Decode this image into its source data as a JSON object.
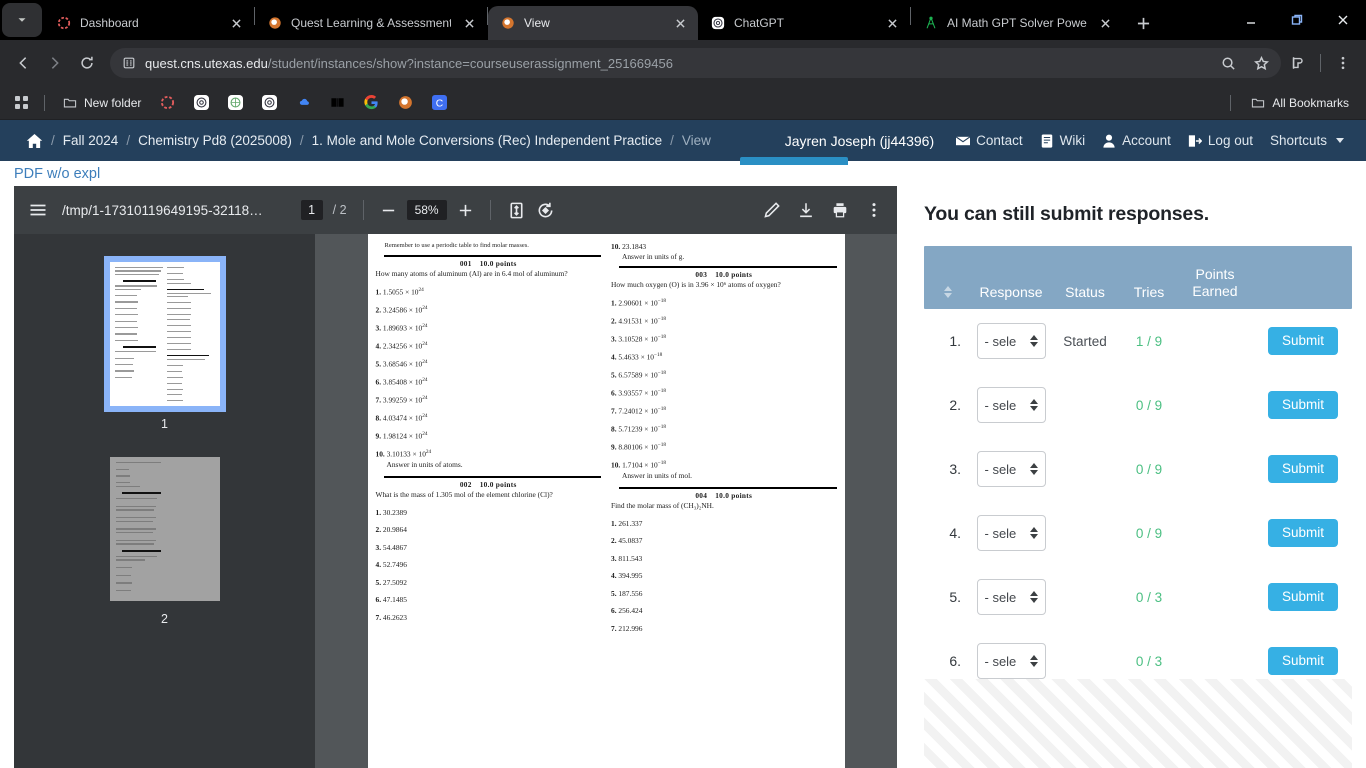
{
  "browser": {
    "tabs": [
      {
        "title": "Dashboard",
        "favicon": "quest-dashboard-icon",
        "active": false
      },
      {
        "title": "Quest Learning & Assessment",
        "favicon": "quest-icon",
        "active": false
      },
      {
        "title": "View",
        "favicon": "quest-icon",
        "active": true
      },
      {
        "title": "ChatGPT",
        "favicon": "openai-icon",
        "active": false
      },
      {
        "title": "AI Math GPT Solver Powered",
        "favicon": "compass-icon",
        "active": false
      }
    ],
    "url_domain": "quest.cns.utexas.edu",
    "url_path": "/student/instances/show?instance=courseuserassignment_251669456",
    "bookmarks": {
      "new_folder": "New folder",
      "all_bookmarks": "All Bookmarks"
    }
  },
  "navbar": {
    "breadcrumbs": [
      {
        "label": "Fall 2024"
      },
      {
        "label": "Chemistry Pd8  (2025008)"
      },
      {
        "label": "1. Mole and Mole Conversions (Rec) Independent Practice"
      },
      {
        "label": "View"
      }
    ],
    "separator": "/",
    "user": "Jayren Joseph (jj44396)",
    "links": [
      {
        "label": "Contact",
        "icon": "envelope-icon"
      },
      {
        "label": "Wiki",
        "icon": "book-icon"
      },
      {
        "label": "Account",
        "icon": "user-icon"
      },
      {
        "label": "Log out",
        "icon": "logout-icon"
      },
      {
        "label": "Shortcuts",
        "icon": "caret-down-icon"
      }
    ]
  },
  "pdf_link_label": "PDF w/o expl",
  "pdf_viewer": {
    "filename": "/tmp/1-17310119649195-32118…",
    "current_page": "1",
    "total_pages": "/ 2",
    "zoom": "58%",
    "thumbnails": [
      {
        "label": "1",
        "selected": true
      },
      {
        "label": "2",
        "selected": false
      }
    ],
    "toolbar_icons": [
      "menu-icon",
      "minus-icon",
      "plus-icon",
      "fit-page-icon",
      "rotate-icon",
      "annotate-pencil-icon",
      "download-icon",
      "print-icon",
      "more-vertical-icon"
    ]
  },
  "document": {
    "intro": "Remember to use a periodic table to find molar masses.",
    "columns": [
      {
        "blocks": [
          {
            "type": "question",
            "number": "001",
            "points": "10.0 points",
            "prompt": "How many atoms of aluminum (Al) are in 6.4 mol of aluminum?",
            "choices": [
              {
                "n": "1.",
                "mantissa": "1.5055 ×",
                "base": "10",
                "exp": "24"
              },
              {
                "n": "2.",
                "mantissa": "3.24586 ×",
                "base": "10",
                "exp": "24"
              },
              {
                "n": "3.",
                "mantissa": "1.89693 ×",
                "base": "10",
                "exp": "24"
              },
              {
                "n": "4.",
                "mantissa": "2.34256 ×",
                "base": "10",
                "exp": "24"
              },
              {
                "n": "5.",
                "mantissa": "3.68546 ×",
                "base": "10",
                "exp": "24"
              },
              {
                "n": "6.",
                "mantissa": "3.85408 ×",
                "base": "10",
                "exp": "24"
              },
              {
                "n": "7.",
                "mantissa": "3.99259 ×",
                "base": "10",
                "exp": "24"
              },
              {
                "n": "8.",
                "mantissa": "4.03474 ×",
                "base": "10",
                "exp": "24"
              },
              {
                "n": "9.",
                "mantissa": "1.98124 ×",
                "base": "10",
                "exp": "24"
              },
              {
                "n": "10.",
                "mantissa": "3.10133 ×",
                "base": "10",
                "exp": "24"
              }
            ],
            "answer_units": "Answer in units of  atoms."
          },
          {
            "type": "question",
            "number": "002",
            "points": "10.0 points",
            "prompt": "What is the mass of 1.305 mol of the element chlorine (Cl)?",
            "choices": [
              {
                "n": "1.",
                "mantissa": "30.2389",
                "base": "",
                "exp": ""
              },
              {
                "n": "2.",
                "mantissa": "20.9864",
                "base": "",
                "exp": ""
              },
              {
                "n": "3.",
                "mantissa": "54.4867",
                "base": "",
                "exp": ""
              },
              {
                "n": "4.",
                "mantissa": "52.7496",
                "base": "",
                "exp": ""
              },
              {
                "n": "5.",
                "mantissa": "27.5092",
                "base": "",
                "exp": ""
              },
              {
                "n": "6.",
                "mantissa": "47.1485",
                "base": "",
                "exp": ""
              },
              {
                "n": "7.",
                "mantissa": "46.2623",
                "base": "",
                "exp": ""
              }
            ],
            "answer_units": ""
          }
        ]
      },
      {
        "blocks": [
          {
            "type": "tail",
            "number": "",
            "points": "",
            "prompt": "",
            "choices": [
              {
                "n": "10.",
                "mantissa": "23.1843",
                "base": "",
                "exp": ""
              }
            ],
            "answer_units": "Answer in units of  g."
          },
          {
            "type": "question",
            "number": "003",
            "points": "10.0 points",
            "prompt": "How much oxygen (O) is in 3.96 × 10⁶ atoms of oxygen?",
            "choices": [
              {
                "n": "1.",
                "mantissa": "2.90601 ×",
                "base": "10",
                "exp": "−18"
              },
              {
                "n": "2.",
                "mantissa": "4.91531 ×",
                "base": "10",
                "exp": "−18"
              },
              {
                "n": "3.",
                "mantissa": "3.10528 ×",
                "base": "10",
                "exp": "−18"
              },
              {
                "n": "4.",
                "mantissa": "5.4633 ×",
                "base": "10",
                "exp": "−18"
              },
              {
                "n": "5.",
                "mantissa": "6.57589 ×",
                "base": "10",
                "exp": "−18"
              },
              {
                "n": "6.",
                "mantissa": "3.93557 ×",
                "base": "10",
                "exp": "−18"
              },
              {
                "n": "7.",
                "mantissa": "7.24012 ×",
                "base": "10",
                "exp": "−18"
              },
              {
                "n": "8.",
                "mantissa": "5.71239 ×",
                "base": "10",
                "exp": "−18"
              },
              {
                "n": "9.",
                "mantissa": "8.80106 ×",
                "base": "10",
                "exp": "−18"
              },
              {
                "n": "10.",
                "mantissa": "1.7104 ×",
                "base": "10",
                "exp": "−18"
              }
            ],
            "answer_units": "Answer in units of  mol."
          },
          {
            "type": "question",
            "number": "004",
            "points": "10.0 points",
            "prompt": "Find the molar mass of (CH₃)₂NH.",
            "choices": [
              {
                "n": "1.",
                "mantissa": "261.337",
                "base": "",
                "exp": ""
              },
              {
                "n": "2.",
                "mantissa": "45.0837",
                "base": "",
                "exp": ""
              },
              {
                "n": "3.",
                "mantissa": "811.543",
                "base": "",
                "exp": ""
              },
              {
                "n": "4.",
                "mantissa": "394.995",
                "base": "",
                "exp": ""
              },
              {
                "n": "5.",
                "mantissa": "187.556",
                "base": "",
                "exp": ""
              },
              {
                "n": "6.",
                "mantissa": "256.424",
                "base": "",
                "exp": ""
              },
              {
                "n": "7.",
                "mantissa": "212.996",
                "base": "",
                "exp": ""
              }
            ],
            "answer_units": ""
          }
        ]
      }
    ]
  },
  "responses": {
    "heading": "You can still submit responses.",
    "columns": {
      "sort": "",
      "response": "Response",
      "status": "Status",
      "tries": "Tries",
      "points_line1": "Points",
      "points_line2": "Earned"
    },
    "select_placeholder": "- sele",
    "submit_label": "Submit",
    "rows": [
      {
        "index": "1.",
        "select": "- sele",
        "status": "Started",
        "tries": "1 / 9",
        "points": "",
        "submit": "Submit"
      },
      {
        "index": "2.",
        "select": "- sele",
        "status": "",
        "tries": "0 / 9",
        "points": "",
        "submit": "Submit"
      },
      {
        "index": "3.",
        "select": "- sele",
        "status": "",
        "tries": "0 / 9",
        "points": "",
        "submit": "Submit"
      },
      {
        "index": "4.",
        "select": "- sele",
        "status": "",
        "tries": "0 / 9",
        "points": "",
        "submit": "Submit"
      },
      {
        "index": "5.",
        "select": "- sele",
        "status": "",
        "tries": "0 / 3",
        "points": "",
        "submit": "Submit"
      },
      {
        "index": "6.",
        "select": "- sele",
        "status": "",
        "tries": "0 / 3",
        "points": "",
        "submit": "Submit"
      }
    ]
  },
  "colors": {
    "navbar_bg": "#24405c",
    "table_header_bg": "#84a7c4",
    "submit_blue": "#36b0e4",
    "tries_green": "#4bbf82",
    "link_blue": "#3d7ebb",
    "tab_indicator": "#2a8fc4"
  }
}
